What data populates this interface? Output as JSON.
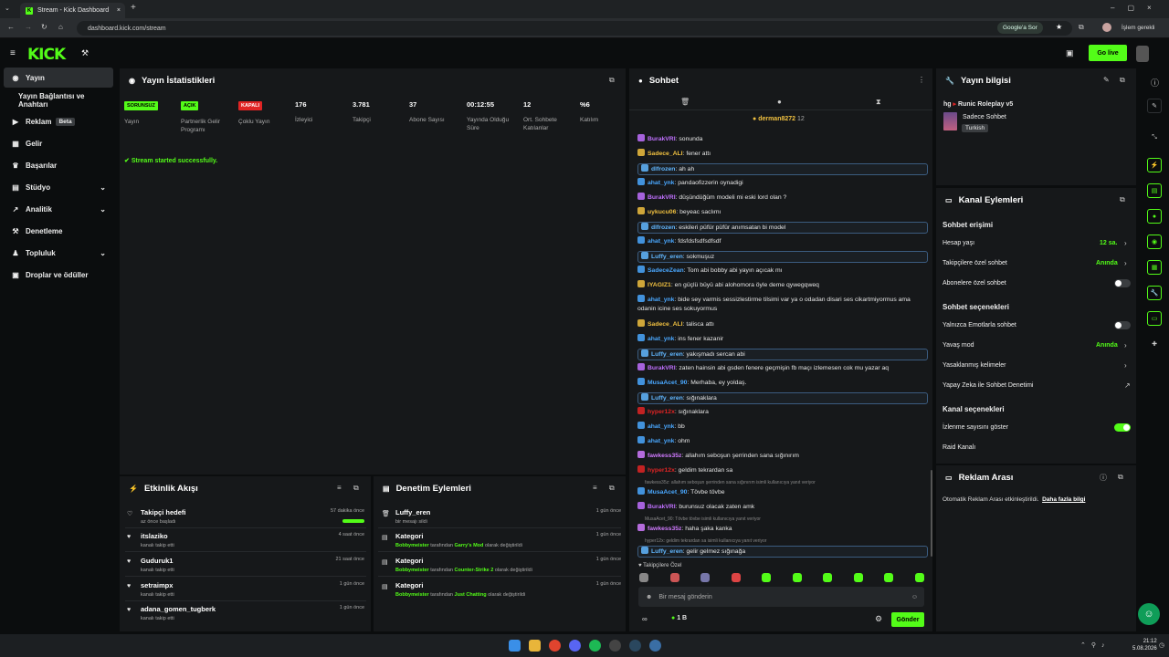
{
  "browser": {
    "tab_title": "Stream - Kick Dashboard",
    "url": "dashboard.kick.com/stream",
    "google_ask": "Google'a Sor",
    "profile_status": "İşlem gerekli"
  },
  "app": {
    "logo": "KICK",
    "go_live": "Go live"
  },
  "sidebar": {
    "items": [
      {
        "label": "Yayın",
        "icon": "broadcast-icon",
        "active": true
      },
      {
        "label": "Yayın Bağlantısı ve Anahtarı",
        "icon": "",
        "sub": true
      },
      {
        "label": "Reklam",
        "icon": "megaphone-icon",
        "badge": "Beta"
      },
      {
        "label": "Gelir",
        "icon": "money-icon"
      },
      {
        "label": "Başarılar",
        "icon": "trophy-icon"
      },
      {
        "label": "Stüdyo",
        "icon": "studio-icon",
        "expandable": true
      },
      {
        "label": "Analitik",
        "icon": "chart-icon",
        "expandable": true
      },
      {
        "label": "Denetleme",
        "icon": "hammer-icon"
      },
      {
        "label": "Topluluk",
        "icon": "community-icon",
        "expandable": true
      },
      {
        "label": "Droplar ve ödüller",
        "icon": "gift-icon"
      }
    ]
  },
  "stats": {
    "title": "Yayın İstatistikleri",
    "items": [
      {
        "value": "SORUNSUZ",
        "label": "Yayın",
        "badge": true,
        "color": "#53fc18"
      },
      {
        "value": "AÇIK",
        "label": "Partnerlik Gelir Programı",
        "badge": true,
        "color": "#53fc18"
      },
      {
        "value": "KAPALI",
        "label": "Çoklu Yayın",
        "badge": true,
        "color": "#e02424"
      },
      {
        "value": "176",
        "label": "İzleyici"
      },
      {
        "value": "3.781",
        "label": "Takipçi"
      },
      {
        "value": "37",
        "label": "Abone Sayısı"
      },
      {
        "value": "00:12:55",
        "label": "Yayında Olduğu Süre"
      },
      {
        "value": "12",
        "label": "Ort. Sohbete Katılanlar"
      },
      {
        "value": "%6",
        "label": "Katılım"
      }
    ],
    "notice": "Stream started successfully."
  },
  "activity": {
    "title": "Etkinlik Akışı",
    "items": [
      {
        "name": "Takipçi hedefi",
        "sub": "az önce başladı",
        "time": "57 dakika önce"
      },
      {
        "name": "itslaziko",
        "sub": "kanalı takip etti",
        "time": "4 saat önce"
      },
      {
        "name": "Guduruk1",
        "sub": "kanalı takip etti",
        "time": "21 saat önce"
      },
      {
        "name": "setraimpx",
        "sub": "kanalı takip etti",
        "time": "1 gün önce"
      },
      {
        "name": "adana_gomen_tugberk",
        "sub": "kanalı takip etti",
        "time": "1 gün önce"
      }
    ]
  },
  "moderation": {
    "title": "Denetim Eylemleri",
    "items": [
      {
        "name": "Luffy_eren",
        "sub": "bir mesajı sildi",
        "time": "1 gün önce"
      },
      {
        "name": "Kategori",
        "actor": "Bobbymeister",
        "mid": "tarafından",
        "target": "Garry's Mod",
        "end": "olarak değiştirildi",
        "time": "1 gün önce"
      },
      {
        "name": "Kategori",
        "actor": "Bobbymeister",
        "mid": "tarafından",
        "target": "Counter-Strike 2",
        "end": "olarak değiştirildi",
        "time": "1 gün önce"
      },
      {
        "name": "Kategori",
        "actor": "Bobbymeister",
        "mid": "tarafından",
        "target": "Just Chatting",
        "end": "olarak değiştirildi",
        "time": "1 gün önce"
      }
    ]
  },
  "chat": {
    "title": "Sohbet",
    "pinned_user": "derman8272",
    "pinned_count": "12",
    "messages": [
      {
        "user": "BurakVRI",
        "color": "#c070ff",
        "text": ": sonunda"
      },
      {
        "user": "Sadece_ALI",
        "color": "#f0c040",
        "text": ": fener attı"
      },
      {
        "user": "dlfrozen",
        "color": "#61b7ff",
        "text": ": ah ah",
        "hl": true
      },
      {
        "user": "ahat_ynk",
        "color": "#4aa8ff",
        "text": ": pandaofizzerin oynadigi"
      },
      {
        "user": "BurakVRI",
        "color": "#c070ff",
        "text": ": düşündüğüm modeli mi eski lord olan ?"
      },
      {
        "user": "uykucu06",
        "color": "#f0c040",
        "text": ": beyeac saclımı"
      },
      {
        "user": "dlfrozen",
        "color": "#61b7ff",
        "text": ": eskileri püfür püfür anımsatan bi model",
        "hl": true
      },
      {
        "user": "ahat_ynk",
        "color": "#4aa8ff",
        "text": ": fdsfdsfsdfsdfsdf"
      },
      {
        "user": "Luffy_eren",
        "color": "#61b7ff",
        "text": ": sokmuşuz",
        "hl": true
      },
      {
        "user": "SadeceZean",
        "color": "#4aa8ff",
        "text": ": Tom abi bobby abi yayın açıcak mı"
      },
      {
        "user": "IYAGIZ1",
        "color": "#f0c040",
        "text": ": en güçlü büyü abi alohomora öyle deme qywegqweq"
      },
      {
        "user": "ahat_ynk",
        "color": "#4aa8ff",
        "text": ": bide sey varmis sessizlestirme tilsimi var ya o odadan disari ses cikartmiyormus ama odanin icine ses sokuyormus",
        "two": true
      },
      {
        "user": "Sadece_ALI",
        "color": "#f0c040",
        "text": ": talisca attı"
      },
      {
        "user": "ahat_ynk",
        "color": "#4aa8ff",
        "text": ": ins fener kazanir"
      },
      {
        "user": "Luffy_eren",
        "color": "#61b7ff",
        "text": ": yakışmadı sercan abi",
        "hl": true
      },
      {
        "user": "BurakVRI",
        "color": "#c070ff",
        "text": ": zaten hainsin abi gsden fenere geçmişin fb maçı izlemesen cok mu yazar aq"
      },
      {
        "user": "MusaAcet_90",
        "color": "#4aa8ff",
        "text": ": Merhaba, ey yoldaş."
      },
      {
        "user": "Luffy_eren",
        "color": "#61b7ff",
        "text": ": sığınaklara",
        "hl": true
      },
      {
        "user": "hyper12x",
        "color": "#e02424",
        "text": ": sığınaklara"
      },
      {
        "user": "ahat_ynk",
        "color": "#4aa8ff",
        "text": ": bb"
      },
      {
        "user": "ahat_ynk",
        "color": "#4aa8ff",
        "text": ": ohm"
      },
      {
        "user": "fawkess35z",
        "color": "#d07aff",
        "text": ": allahım seboşun şerrinden sana sığınırım"
      },
      {
        "user": "hyper12x",
        "color": "#e02424",
        "text": ": geldim tekrardan sa"
      },
      {
        "user": "MusaAcet_90",
        "color": "#4aa8ff",
        "text": ": Tövbe tövbe",
        "reply": "fawkess35z: allahım seboşun şerrinden sana sığınırım isimli kullanıcıya yanıt veriyor"
      },
      {
        "user": "BurakVRI",
        "color": "#c070ff",
        "text": ": burunsuz olacak zaten amk"
      },
      {
        "user": "fawkess35z",
        "color": "#d07aff",
        "text": ": haha şaka kanka",
        "reply": "MusaAcet_90: Tövbe tövbe isimli kullanıcıya yanıt veriyor"
      },
      {
        "user": "Luffy_eren",
        "color": "#61b7ff",
        "text": ": gelir gelmez sığınağa",
        "hl": true,
        "reply": "hyper12x: geldim tekrardan sa isimli kullanıcıya yanıt veriyor"
      }
    ],
    "followers_only": "Takipçilere Özel",
    "input_placeholder": "Bir mesaj gönderin",
    "points": "1 B",
    "send": "Gönder",
    "viewers_icon": "∞"
  },
  "stream_info": {
    "title": "Yayın bilgisi",
    "prefix": "hg",
    "game_title": "Runic Roleplay v5",
    "category": "Sadece Sohbet",
    "language": "Turkish"
  },
  "channel_actions": {
    "title": "Kanal Eylemleri",
    "chat_access": "Sohbet erişimi",
    "account_age": "Hesap yaşı",
    "account_age_val": "12 sa.",
    "followers_only": "Takipçilere özel sohbet",
    "followers_only_val": "Anında",
    "subs_only": "Abonelere özel sohbet",
    "chat_options": "Sohbet seçenekleri",
    "emotes_only": "Yalnızca Emotlarla sohbet",
    "slow_mode": "Yavaş mod",
    "slow_mode_val": "Anında",
    "banned_words": "Yasaklanmış kelimeler",
    "ai_mod": "Yapay Zeka ile Sohbet Denetimi",
    "channel_options": "Kanal seçenekleri",
    "show_viewers": "İzlenme sayısını göster",
    "raid": "Raid Kanalı"
  },
  "ad_break": {
    "title": "Reklam Arası",
    "text": "Otomatik Reklam Arası etkinleştirildi.",
    "link": "Daha fazla bilgi"
  },
  "taskbar": {
    "time": "21:12",
    "date": "5.08.2026"
  }
}
